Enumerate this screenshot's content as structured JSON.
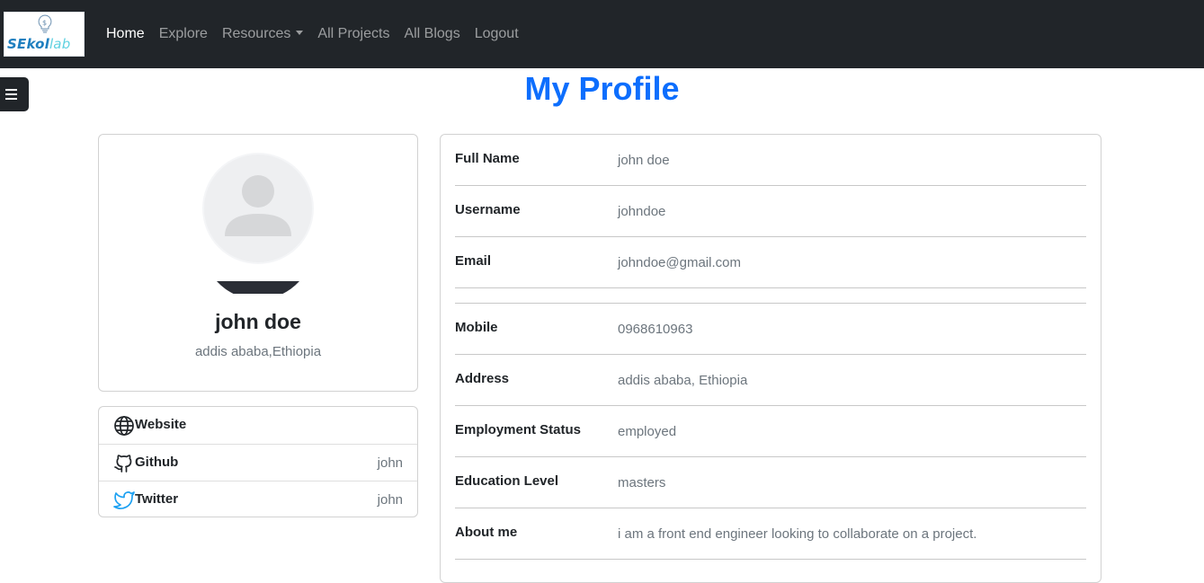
{
  "nav": {
    "logo_text_main": "SEkol",
    "logo_text_accent": "lab",
    "home": "Home",
    "explore": "Explore",
    "resources": "Resources",
    "all_projects": "All Projects",
    "all_blogs": "All Blogs",
    "logout": "Logout"
  },
  "page": {
    "title": "My Profile"
  },
  "profile": {
    "name": "john doe",
    "location": "addis ababa,Ethiopia"
  },
  "social": [
    {
      "icon": "globe-icon",
      "label": "Website",
      "value": ""
    },
    {
      "icon": "github-icon",
      "label": "Github",
      "value": "john"
    },
    {
      "icon": "twitter-icon",
      "label": "Twitter",
      "value": "john"
    }
  ],
  "details": [
    {
      "label": "Full Name",
      "value": "john doe"
    },
    {
      "label": "Username",
      "value": "johndoe"
    },
    {
      "label": "Email",
      "value": "johndoe@gmail.com"
    },
    {
      "label": "Mobile",
      "value": "0968610963"
    },
    {
      "label": "Address",
      "value": "addis ababa, Ethiopia"
    },
    {
      "label": "Employment Status",
      "value": "employed"
    },
    {
      "label": "Education Level",
      "value": "masters"
    },
    {
      "label": "About me",
      "value": "i am a front end engineer looking to collaborate on a project."
    }
  ],
  "colors": {
    "navbar": "#212529",
    "title": "#0d6efd",
    "twitter": "#1da1f2"
  }
}
